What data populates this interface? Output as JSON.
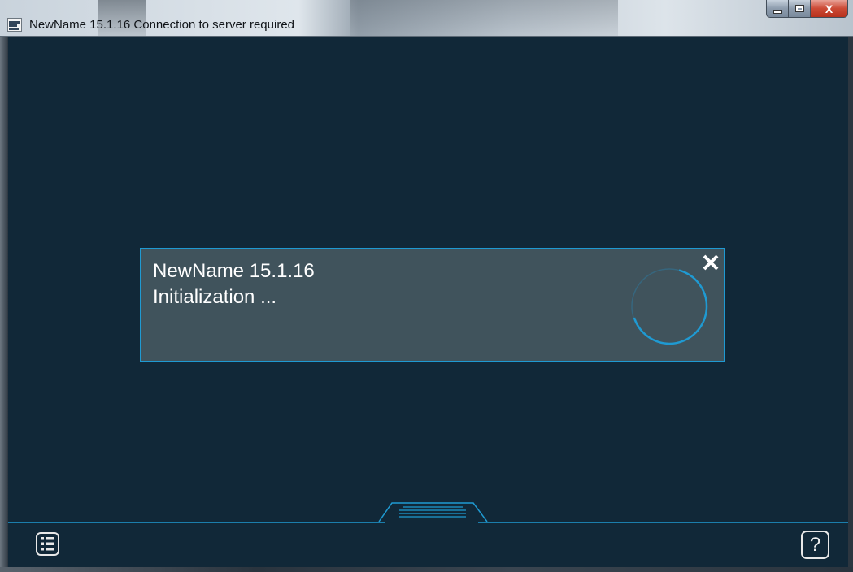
{
  "window": {
    "title": "NewName 15.1.16 Connection to server required",
    "icon": "app-icon",
    "controls": {
      "minimize_icon": "minimize-icon",
      "maximize_icon": "maximize-icon",
      "close_label": "X"
    }
  },
  "dialog": {
    "title": "NewName 15.1.16",
    "status": "Initialization ...",
    "close_icon": "close-x-icon",
    "spinner_icon": "loading-spinner-icon"
  },
  "footer": {
    "menu_icon": "list-menu-icon",
    "handle_icon": "drawer-handle-icon",
    "help_label": "?"
  },
  "colors": {
    "background": "#112838",
    "dialog_background": "#40535c",
    "accent": "#1f9ad2",
    "text": "#ffffff"
  }
}
